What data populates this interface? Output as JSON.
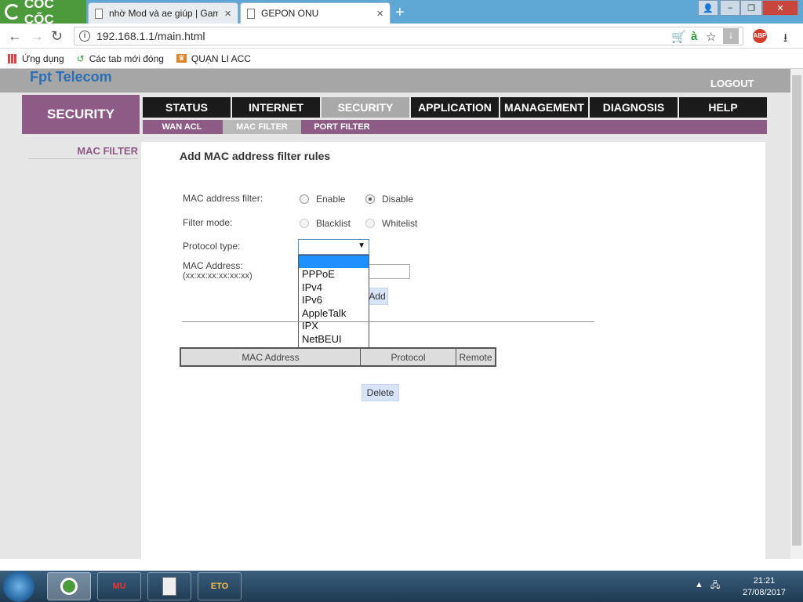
{
  "browser": {
    "logo": "CỐC CỐC",
    "tabs": [
      {
        "label": "nhờ Mod và ae giúp | Gam",
        "active": false
      },
      {
        "label": "GEPON ONU",
        "active": true
      }
    ],
    "url": "192.168.1.1/main.html",
    "bookmarks": [
      "Ứng dụng",
      "Các tab mới đóng",
      "QUẠN LI ACC"
    ],
    "adblock_label": "ABP"
  },
  "router": {
    "brand": "Fpt Telecom",
    "logout": "LOGOUT",
    "section_title": "SECURITY",
    "main_menu": [
      "STATUS",
      "INTERNET",
      "SECURITY",
      "APPLICATION",
      "MANAGEMENT",
      "DIAGNOSIS",
      "HELP"
    ],
    "main_menu_selected": "SECURITY",
    "sub_menu": [
      "WAN ACL",
      "MAC FILTER",
      "PORT FILTER"
    ],
    "sub_menu_selected": "MAC FILTER",
    "side_menu_item": "MAC FILTER"
  },
  "form": {
    "heading": "Add MAC address filter rules",
    "mac_filter_label": "MAC address filter:",
    "enable": "Enable",
    "disable": "Disable",
    "mac_filter_value": "Disable",
    "filter_mode_label": "Filter mode:",
    "blacklist": "Blacklist",
    "whitelist": "Whitelist",
    "protocol_label": "Protocol type:",
    "protocol_value": "",
    "protocol_options": [
      "",
      "PPPoE",
      "IPv4",
      "IPv6",
      "AppleTalk",
      "IPX",
      "NetBEUI"
    ],
    "mac_label": "MAC Address:",
    "mac_hint": "(xx:xx:xx:xx:xx:xx)",
    "mac_value": "",
    "add_button": "Add",
    "table_headers": [
      "MAC Address",
      "Protocol",
      "Remote"
    ],
    "delete_button": "Delete"
  },
  "taskbar": {
    "apps": [
      "MU",
      "ETO"
    ],
    "time": "21:21",
    "date": "27/08/2017"
  },
  "colors": {
    "accent": "#8e5a86",
    "menu_bg": "#1b1b1b",
    "selected_menu": "#a9a9a9",
    "highlight": "#1e90ff"
  }
}
